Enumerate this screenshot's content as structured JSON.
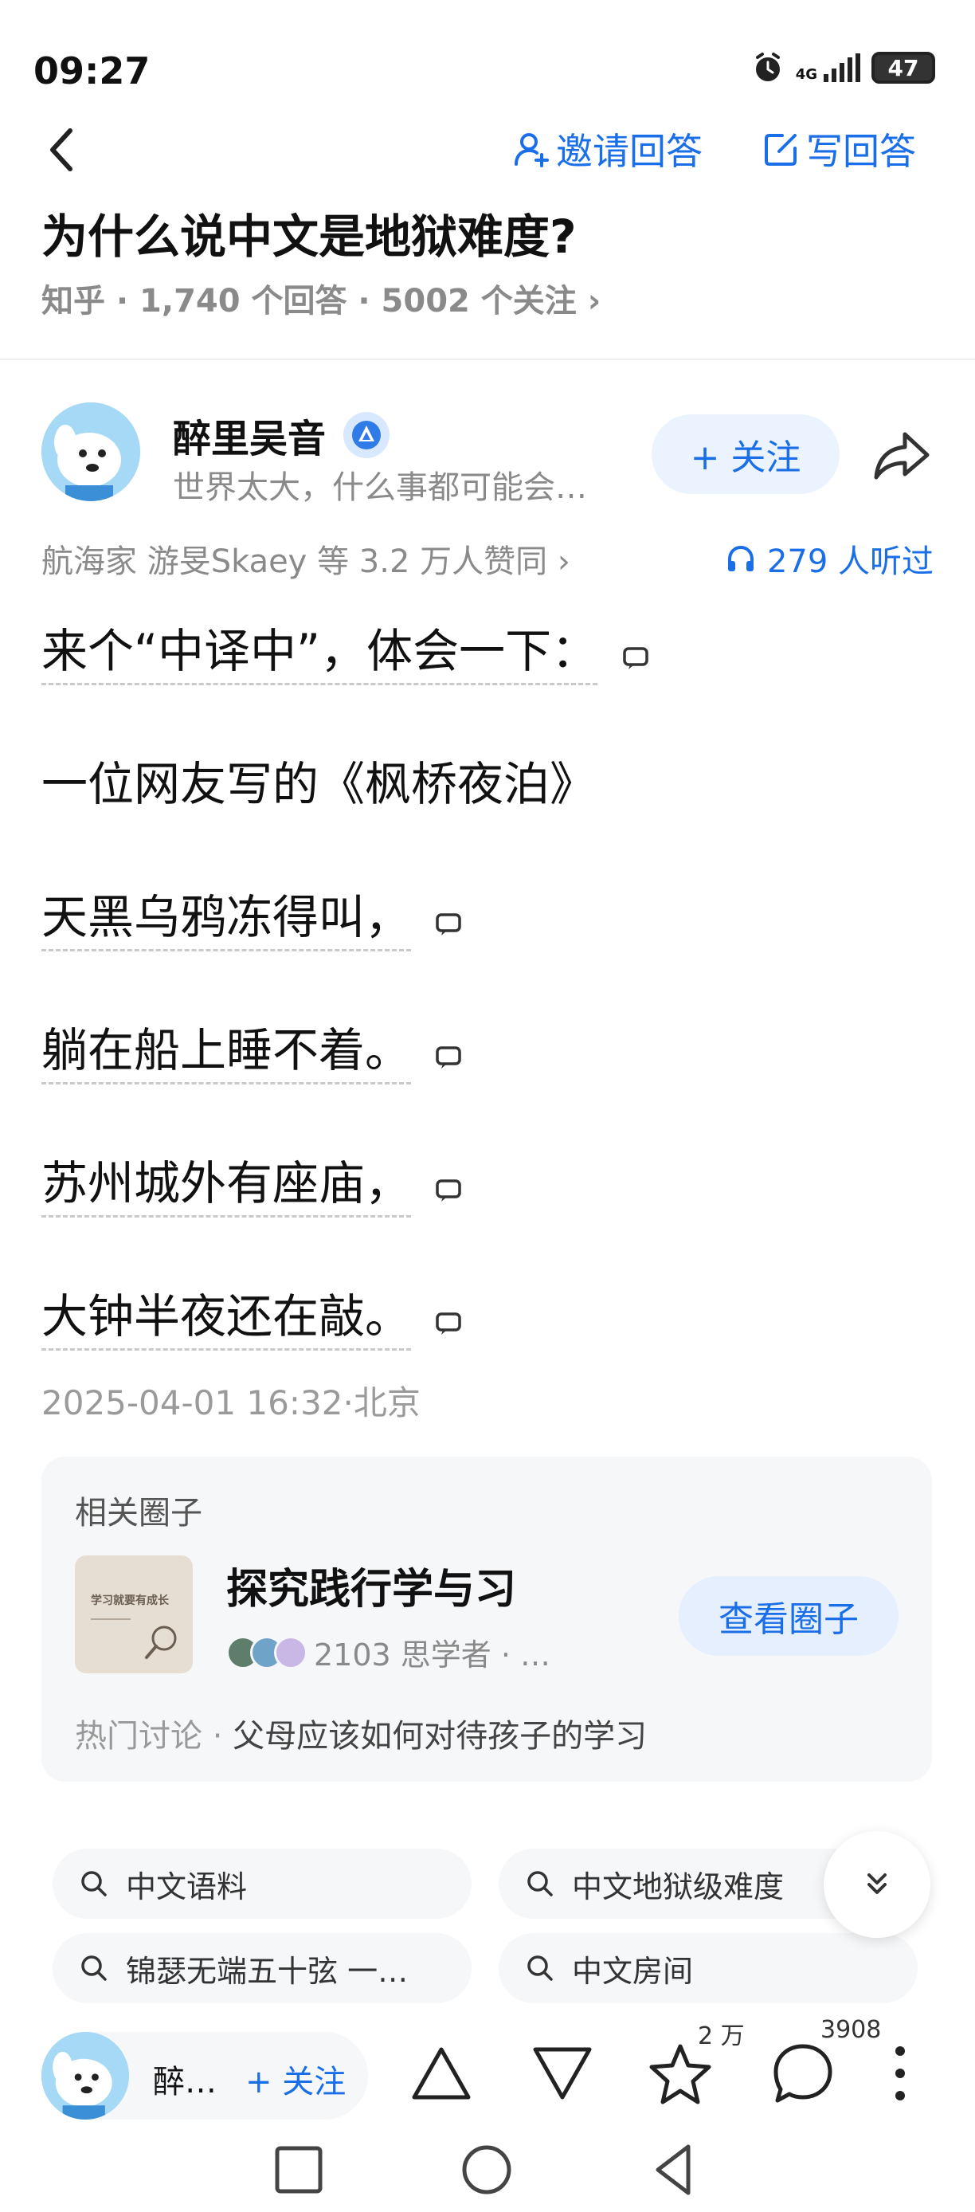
{
  "status": {
    "time": "09:27",
    "network": "4G",
    "battery": "47"
  },
  "nav": {
    "invite_label": "邀请回答",
    "write_label": "写回答"
  },
  "question": {
    "title": "为什么说中文是地狱难度?",
    "meta": "知乎 · 1,740 个回答 · 5002 个关注 ›"
  },
  "author": {
    "name": "醉里吴音",
    "bio": "世界太大，什么事都可能会…",
    "follow_label": "+ 关注"
  },
  "stats": {
    "likes": "航海家 游旻Skaey 等 3.2 万人赞同 ›",
    "listens": "279 人听过"
  },
  "content": {
    "lines": [
      "来个“中译中”，体会一下：",
      "一位网友写的《枫桥夜泊》",
      "天黑乌鸦冻得叫，",
      "躺在船上睡不着。",
      "苏州城外有座庙，",
      "大钟半夜还在敲。"
    ]
  },
  "date": "2025-04-01 16:32·北京",
  "circle": {
    "label": "相关圈子",
    "thumb_text": "学习就要有成长",
    "name": "探究践行学与习",
    "members": "2103 思学者 · …",
    "button": "查看圈子",
    "hot_prefix": "热门讨论 · ",
    "hot_topic": "父母应该如何对待孩子的学习"
  },
  "search_chips": [
    "中文语料",
    "中文地狱级难度",
    "锦瑟无端五十弦 一…",
    "中文房间"
  ],
  "bottom": {
    "author_short": "醉…",
    "follow_label": "+ 关注",
    "favorites_count": "2 万",
    "comments_count": "3908"
  },
  "colors": {
    "accent": "#1a6fe8",
    "muted": "#8a8a8a",
    "card_bg": "#f6f7f9"
  }
}
